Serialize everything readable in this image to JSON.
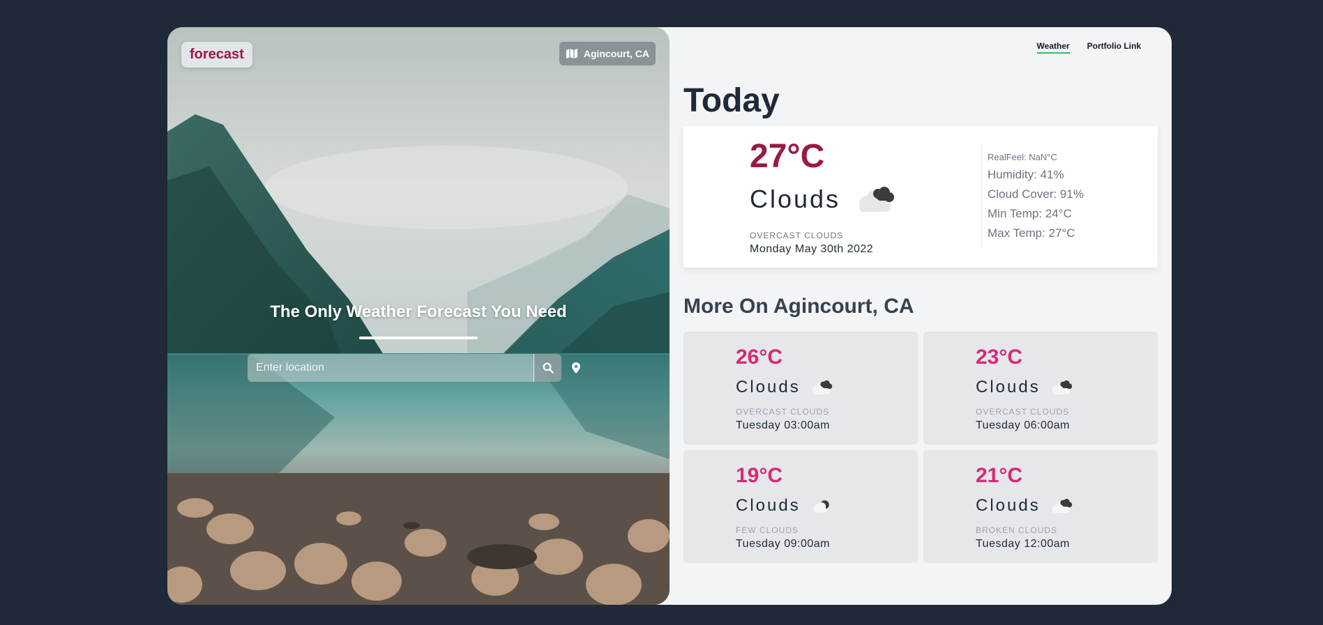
{
  "hero": {
    "logo": "forecast",
    "location_badge": "Agincourt, CA",
    "tagline": "The Only Weather Forecast You Need",
    "search": {
      "placeholder": "Enter location",
      "value": ""
    }
  },
  "nav": {
    "items": [
      {
        "label": "Weather",
        "active": true
      },
      {
        "label": "Portfolio Link",
        "active": false
      }
    ]
  },
  "today": {
    "title": "Today",
    "temp": "27°C",
    "condition": "Clouds",
    "description": "OVERCAST CLOUDS",
    "date": "Monday May 30th 2022",
    "icon": "broken-clouds-icon",
    "details": {
      "realfeel": "RealFeel: NaN°C",
      "humidity": "Humidity: 41%",
      "cloud_cover": "Cloud Cover: 91%",
      "min_temp": "Min Temp: 24°C",
      "max_temp": "Max Temp: 27°C"
    }
  },
  "more": {
    "title": "More On Agincourt, CA",
    "forecasts": [
      {
        "temp": "26°C",
        "condition": "Clouds",
        "description": "OVERCAST CLOUDS",
        "time": "Tuesday 03:00am",
        "icon": "broken-clouds-icon"
      },
      {
        "temp": "23°C",
        "condition": "Clouds",
        "description": "OVERCAST CLOUDS",
        "time": "Tuesday 06:00am",
        "icon": "broken-clouds-icon"
      },
      {
        "temp": "19°C",
        "condition": "Clouds",
        "description": "FEW CLOUDS",
        "time": "Tuesday 09:00am",
        "icon": "few-clouds-icon"
      },
      {
        "temp": "21°C",
        "condition": "Clouds",
        "description": "BROKEN CLOUDS",
        "time": "Tuesday 12:00am",
        "icon": "broken-clouds-icon"
      }
    ]
  },
  "colors": {
    "page_bg": "#1f2937",
    "accent_temp": "#9d1747",
    "forecast_temp": "#db2777",
    "nav_active": "#22c55e"
  }
}
